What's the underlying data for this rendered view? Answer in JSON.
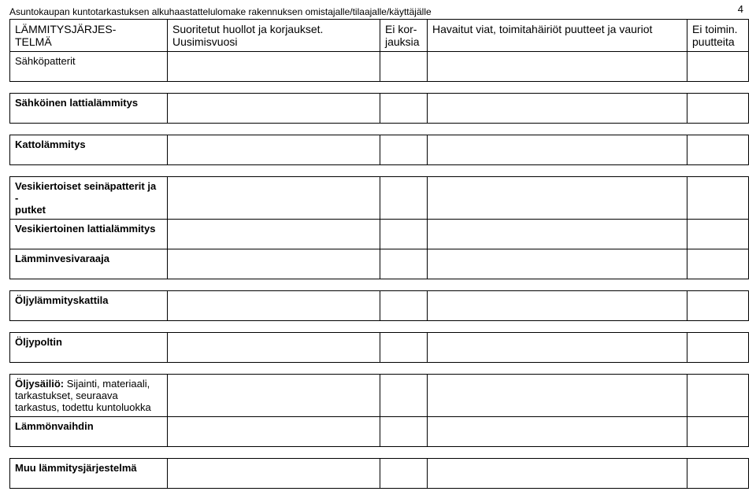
{
  "page_number": "4",
  "doc_title": "Asuntokaupan kuntotarkastuksen alkuhaastattelulomake rakennuksen omistajalle/tilaajalle/käyttäjälle",
  "header": {
    "col1_line1": "LÄMMITYSJÄRJES-",
    "col1_line2": "TELMÄ",
    "col2_line1": "Suoritetut huollot ja korjaukset.",
    "col2_line2": "Uusimisvuosi",
    "col3_line1": "Ei kor-",
    "col3_line2": "jauksia",
    "col4": "Havaitut viat, toimitahäiriöt puutteet ja vauriot",
    "col5_line1": "Ei toimin.",
    "col5_line2": "puutteita"
  },
  "rows": {
    "r1": "Sähköpatterit",
    "r2": "Sähköinen lattialämmitys",
    "r3": "Kattolämmitys",
    "r4_line1": "Vesikiertoiset seinäpatterit ja -",
    "r4_line2": "putket",
    "r5": "Vesikiertoinen lattialämmitys",
    "r6": "Lämminvesivaraaja",
    "r7": "Öljylämmityskattila",
    "r8": "Öljypoltin",
    "r9_bold": "Öljysäiliö:",
    "r9_rest": " Sijainti, materiaali, tarkastukset, seuraava tarkastus, todettu kuntoluokka",
    "r10": "Lämmönvaihdin",
    "r11": "Muu lämmitysjärjestelmä"
  }
}
